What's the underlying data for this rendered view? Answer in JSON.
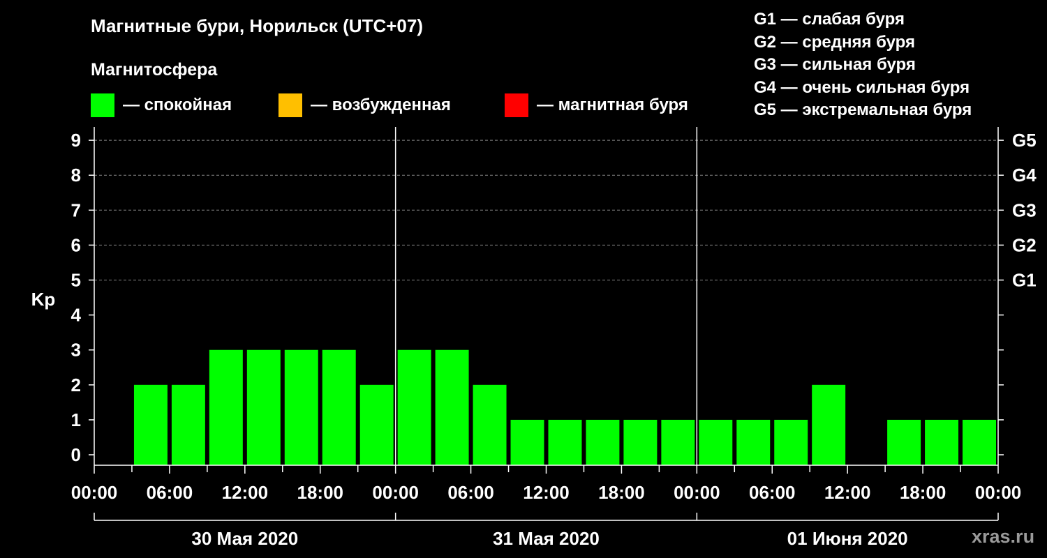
{
  "title": "Магнитные бури, Норильск (UTC+07)",
  "subtitle": "Магнитосфера",
  "legend": [
    {
      "label": "— спокойная",
      "color": "#00ff00"
    },
    {
      "label": "— возбужденная",
      "color": "#ffbf00"
    },
    {
      "label": "— магнитная буря",
      "color": "#ff0000"
    }
  ],
  "g_legend": [
    "G1 — слабая буря",
    "G2 — средняя буря",
    "G3 — сильная буря",
    "G4 — очень сильная буря",
    "G5 — экстремальная буря"
  ],
  "watermark": "xras.ru",
  "chart_data": {
    "type": "bar",
    "ylabel": "Kp",
    "ylim": [
      0,
      9
    ],
    "yticks": [
      0,
      1,
      2,
      3,
      4,
      5,
      6,
      7,
      8,
      9
    ],
    "right_labels": [
      {
        "kp": 5,
        "label": "G1"
      },
      {
        "kp": 6,
        "label": "G2"
      },
      {
        "kp": 7,
        "label": "G3"
      },
      {
        "kp": 8,
        "label": "G4"
      },
      {
        "kp": 9,
        "label": "G5"
      }
    ],
    "xtick_labels": [
      "00:00",
      "06:00",
      "12:00",
      "18:00",
      "00:00",
      "06:00",
      "12:00",
      "18:00",
      "00:00",
      "06:00",
      "12:00",
      "18:00",
      "00:00"
    ],
    "days": [
      "30 Мая 2020",
      "31 Мая 2020",
      "01 Июня 2020"
    ],
    "values": [
      null,
      2,
      2,
      3,
      3,
      3,
      3,
      2,
      3,
      3,
      2,
      1,
      1,
      1,
      1,
      1,
      1,
      1,
      1,
      2,
      null,
      1,
      1,
      1
    ],
    "bar_color": "#00ff00",
    "grid": true
  }
}
